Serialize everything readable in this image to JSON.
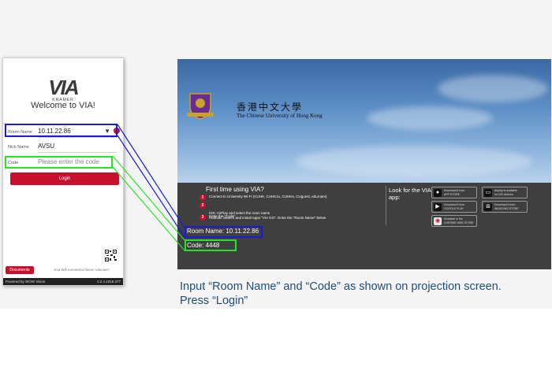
{
  "phone_app": {
    "logo": "VIA",
    "logo_sub": "KRAMER",
    "welcome": "Welcome to VIA!",
    "room_name_label": "Room Name",
    "room_name_value": "10.11.22.86",
    "marker_number": "6",
    "nick_name_label": "Nick Name",
    "nick_name_value": "AVSU",
    "code_label": "Code",
    "code_placeholder": "Please enter the code",
    "login_button": "Login",
    "documents_button": "Documents",
    "wifi_note": "Your Wifi Connection Name 'eduroam'",
    "footer_left": "Powered by WOW Vision",
    "footer_right": "V.2.4.1018.377"
  },
  "projection": {
    "university_cn": "香港中文大學",
    "university_en": "The Chinese University of Hong Kong",
    "first_time_title": "First time using VIA?",
    "steps": [
      {
        "num": "1",
        "text": "Connect to University Wi-Fi (CUHK, CUHK1x, CUHKa, CUguest, eduroam)"
      },
      {
        "num": "2",
        "text": "iOS: AirPlay and select the room name\nAndroid: Search and install Apps \"VIA GO\". Enter the \"Room Name\" below"
      },
      {
        "num": "3",
        "text": "Enter the \"Code\""
      }
    ],
    "look_title": "Look for the VIA app:",
    "stores": [
      {
        "icon": "apple-icon",
        "line1": "Download it from",
        "line2": "APP STORE"
      },
      {
        "icon": "airplay-icon",
        "line1": "Airplay is available",
        "line2": "for iOS devices"
      },
      {
        "icon": "google-play-icon",
        "line1": "Download it from",
        "line2": "GOOGLE PLAY"
      },
      {
        "icon": "windows-icon",
        "line1": "Download it from",
        "line2": "WINDOWS STORE"
      },
      {
        "icon": "chrome-icon",
        "line1": "Available in the",
        "line2": "CHROME WEB STORE"
      }
    ],
    "room_name_display": "Room Name: 10.11.22.86",
    "code_display": "Code: 4448"
  },
  "caption": {
    "line1": "Input “Room Name” and “Code” as shown on projection screen.",
    "line2": "Press “Login”"
  },
  "colors": {
    "accent_red": "#c8102e",
    "highlight_blue": "#1a1adb",
    "highlight_green": "#22e622",
    "caption_blue": "#1f4e79"
  }
}
